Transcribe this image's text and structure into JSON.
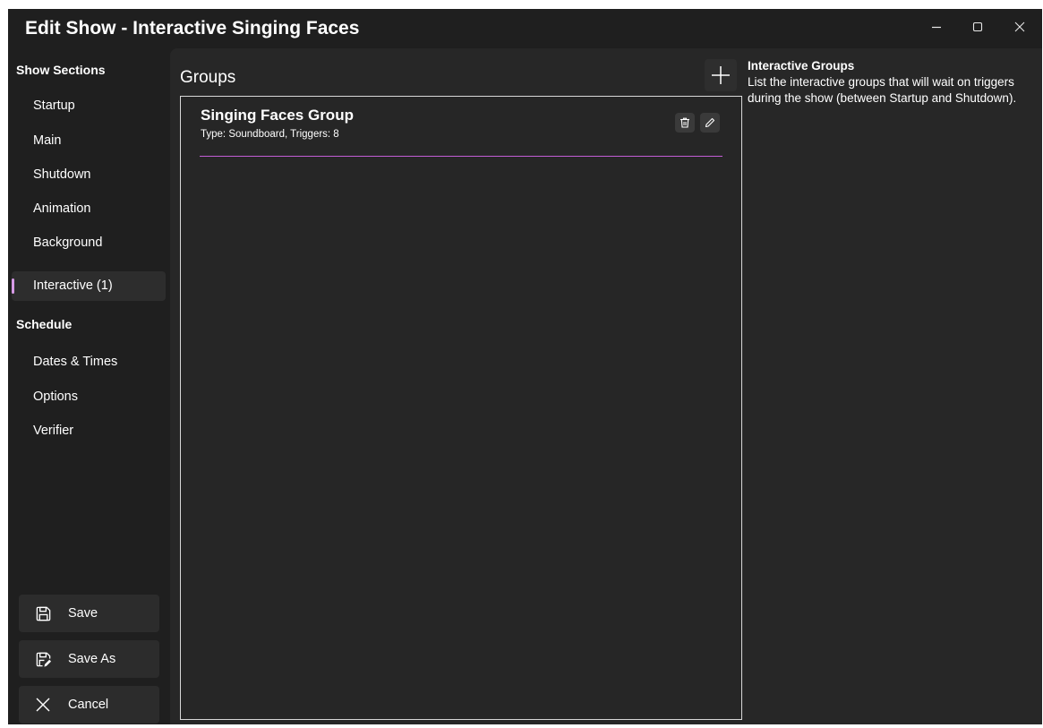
{
  "window": {
    "title": "Edit Show - Interactive Singing Faces",
    "controls": [
      "minimize-icon",
      "maximize-icon",
      "close-icon"
    ]
  },
  "sidebar": {
    "show_sections_header": "Show Sections",
    "show_sections": [
      {
        "label": "Startup",
        "selected": false
      },
      {
        "label": "Main",
        "selected": false
      },
      {
        "label": "Shutdown",
        "selected": false
      },
      {
        "label": "Animation",
        "selected": false
      },
      {
        "label": "Background",
        "selected": false
      },
      {
        "label": "Interactive (1)",
        "selected": true
      }
    ],
    "schedule_header": "Schedule",
    "schedule": [
      {
        "label": "Dates & Times"
      },
      {
        "label": "Options"
      },
      {
        "label": "Verifier"
      }
    ],
    "buttons": [
      {
        "label": "Save",
        "icon": "save-icon"
      },
      {
        "label": "Save As",
        "icon": "save-as-icon"
      },
      {
        "label": "Cancel",
        "icon": "close-icon"
      }
    ]
  },
  "main": {
    "groups_label": "Groups",
    "add_icon": "plus-icon",
    "groups": [
      {
        "name": "Singing Faces Group",
        "meta": "Type: Soundboard, Triggers: 8",
        "actions": [
          "delete-icon",
          "edit-icon"
        ]
      }
    ]
  },
  "help": {
    "title": "Interactive Groups",
    "body": "List the interactive groups that will wait on triggers during the show (between Startup and Shutdown)."
  },
  "colors": {
    "window_bg": "#1f1f1f",
    "content_bg": "#272727",
    "accent": "#c25dd6",
    "selection_indicator": "#d79ae6"
  }
}
